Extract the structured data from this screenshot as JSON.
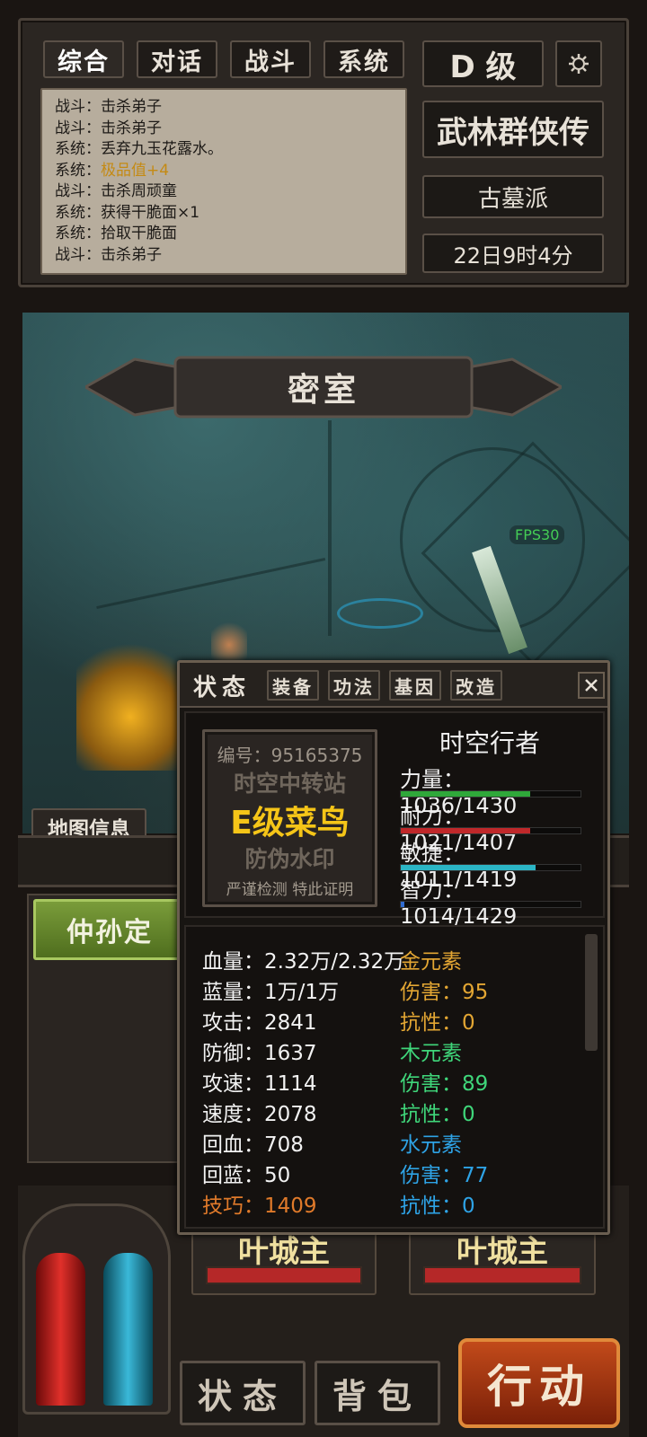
{
  "chat_tabs": [
    "综合",
    "对话",
    "战斗",
    "系统"
  ],
  "rank": "D 级",
  "settings_icon": "gear-icon",
  "game_title": "武林群侠传",
  "sect": "古墓派",
  "game_time": "22日9时4分",
  "log": [
    {
      "text": "战斗：击杀弟子"
    },
    {
      "text": "战斗：击杀弟子"
    },
    {
      "text": "系统：丢弃九玉花露水。"
    },
    {
      "prefix": "系统：",
      "highlight": "极品值+4"
    },
    {
      "text": "战斗：击杀周顽童"
    },
    {
      "text": "系统：获得干脆面×1"
    },
    {
      "text": "系统：拾取干脆面"
    },
    {
      "text": "战斗：击杀弟子"
    }
  ],
  "location": "密室",
  "fps": "FPS30",
  "map_info_button": "地图信息",
  "npc_name": "仲孙定",
  "enemies": [
    {
      "name": "叶城主",
      "hp": 1.0
    },
    {
      "name": "叶城主",
      "hp": 1.0
    }
  ],
  "bottom_buttons": {
    "status": "状态",
    "bag": "背包",
    "action": "行动"
  },
  "status_dialog": {
    "title": "状态",
    "tabs": [
      "装备",
      "功法",
      "基因",
      "改造"
    ],
    "close_icon": "close-icon",
    "badge": {
      "id": "编号：95165375",
      "line1": "时空中转站",
      "line2": "E级菜鸟",
      "line3": "防伪水印",
      "line4": "严谨检测 特此证明"
    },
    "player_title": "时空行者",
    "stats": [
      {
        "label": "力量：1036/1430",
        "ratio": 0.72,
        "color": "#2fa83a"
      },
      {
        "label": "耐力：1021/1407",
        "ratio": 0.72,
        "color": "#c0282a"
      },
      {
        "label": "敏捷：1011/1419",
        "ratio": 0.75,
        "color": "#2bb5c5"
      },
      {
        "label": "智力：1014/1429",
        "ratio": 0.02,
        "color": "#2f6bd0"
      }
    ],
    "attributes_left": [
      {
        "text": "血量：2.32万/2.32万",
        "color": "#f2f2f2"
      },
      {
        "text": "蓝量：1万/1万",
        "color": "#f2f2f2"
      },
      {
        "text": "攻击：2841",
        "color": "#f2f2f2"
      },
      {
        "text": "防御：1637",
        "color": "#f2f2f2"
      },
      {
        "text": "攻速：1114",
        "color": "#f2f2f2"
      },
      {
        "text": "速度：2078",
        "color": "#f2f2f2"
      },
      {
        "text": "回血：708",
        "color": "#f2f2f2"
      },
      {
        "text": "回蓝：50",
        "color": "#f2f2f2"
      },
      {
        "text": "技巧：1409",
        "color": "#e07a2a"
      }
    ],
    "attributes_right": [
      {
        "text": "金元素",
        "color": "#e3a633"
      },
      {
        "text": "伤害：95",
        "color": "#e3a633"
      },
      {
        "text": "抗性：0",
        "color": "#e3a633"
      },
      {
        "text": "木元素",
        "color": "#3fd67a"
      },
      {
        "text": "伤害：89",
        "color": "#3fd67a"
      },
      {
        "text": "抗性：0",
        "color": "#3fd67a"
      },
      {
        "text": "水元素",
        "color": "#2ea3e6"
      },
      {
        "text": "伤害：77",
        "color": "#2ea3e6"
      },
      {
        "text": "抗性：0",
        "color": "#2ea3e6"
      }
    ]
  }
}
